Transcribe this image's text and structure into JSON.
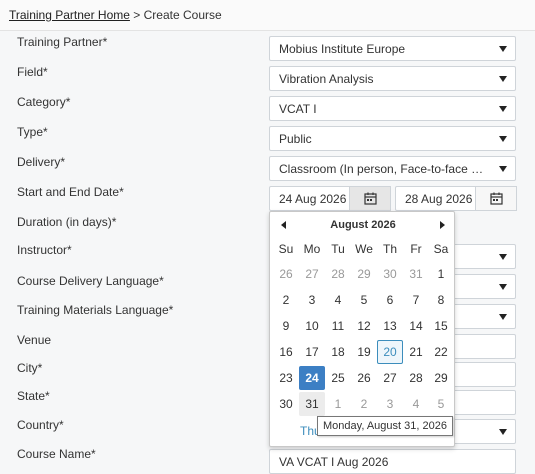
{
  "breadcrumb": {
    "home": "Training Partner Home",
    "separator": " > ",
    "current": "Create Course"
  },
  "labels": {
    "training_partner": "Training Partner*",
    "field": "Field*",
    "category": "Category*",
    "type": "Type*",
    "delivery": "Delivery*",
    "dates": "Start and End Date*",
    "duration": "Duration (in days)*",
    "instructor": "Instructor*",
    "course_language": "Course Delivery Language*",
    "materials_language": "Training Materials Language*",
    "venue": "Venue",
    "city": "City*",
    "state": "State*",
    "country": "Country*",
    "course_name": "Course Name*"
  },
  "values": {
    "training_partner": "Mobius Institute Europe",
    "field": "Vibration Analysis",
    "category": "VCAT I",
    "type": "Public",
    "delivery": "Classroom (In person, Face-to-face sess...",
    "start_date": "24 Aug 2026",
    "end_date": "28 Aug 2026",
    "course_name": "VA VCAT I Aug 2026"
  },
  "calendar": {
    "title": "August 2026",
    "dow": [
      "Su",
      "Mo",
      "Tu",
      "We",
      "Th",
      "Fr",
      "Sa"
    ],
    "weeks": [
      [
        "26",
        "27",
        "28",
        "29",
        "30",
        "31",
        "1"
      ],
      [
        "2",
        "3",
        "4",
        "5",
        "6",
        "7",
        "8"
      ],
      [
        "9",
        "10",
        "11",
        "12",
        "13",
        "14",
        "15"
      ],
      [
        "16",
        "17",
        "18",
        "19",
        "20",
        "21",
        "22"
      ],
      [
        "23",
        "24",
        "25",
        "26",
        "27",
        "28",
        "29"
      ],
      [
        "30",
        "31",
        "1",
        "2",
        "3",
        "4",
        "5"
      ]
    ],
    "today_link": "Thu",
    "tooltip": "Monday, August 31, 2026"
  },
  "colors": {
    "accent": "#3c7fc4",
    "today_border": "#3c8dbc"
  }
}
